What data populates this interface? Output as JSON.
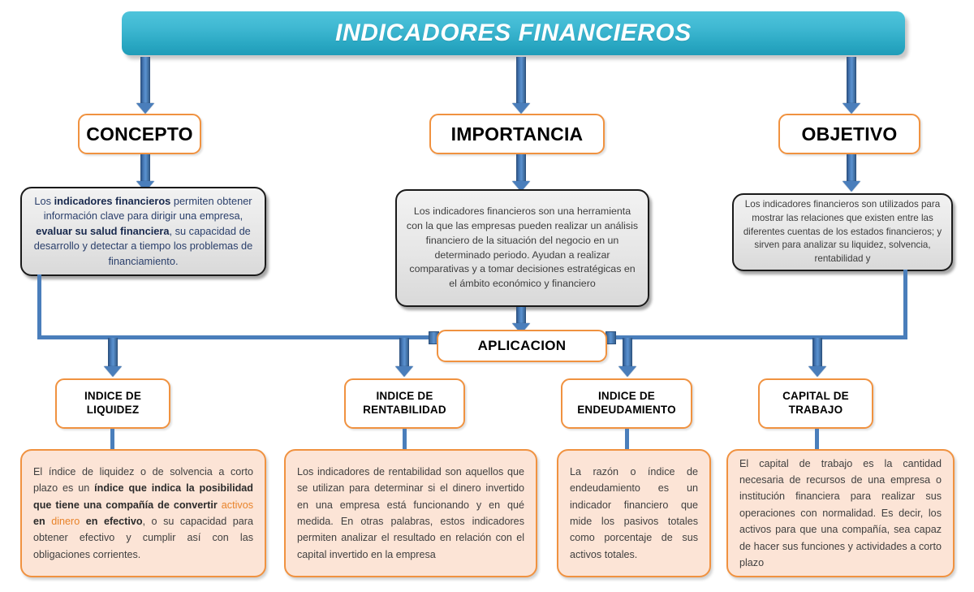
{
  "banner": {
    "title": "INDICADORES FINANCIEROS"
  },
  "colors": {
    "banner_teal": "#3fb8d2",
    "node_border_orange": "#f09240",
    "arrow_blue": "#4a7ebb",
    "peach_fill": "#fce4d6",
    "gray_fill": "#e6e6e6",
    "highlight_orange": "#e8832a",
    "blue_text": "#2a3f6b"
  },
  "level1": [
    {
      "id": "concepto",
      "label": "CONCEPTO"
    },
    {
      "id": "importancia",
      "label": "IMPORTANCIA"
    },
    {
      "id": "objetivo",
      "label": "OBJETIVO"
    }
  ],
  "descriptions": {
    "concepto": {
      "part1": "Los ",
      "bold1": "indicadores financieros",
      "part2": " permiten obtener información clave para dirigir una empresa, ",
      "bold2": "evaluar su salud financiera",
      "part3": ", su capacidad de desarrollo y detectar a tiempo los problemas de financiamiento."
    },
    "importancia": {
      "text": "Los indicadores financieros son una herramienta con la que las empresas pueden realizar un análisis financiero de la situación del negocio en un determinado periodo. Ayudan a realizar comparativas y a tomar decisiones estratégicas en el ámbito económico y financiero"
    },
    "objetivo": {
      "text": "Los indicadores financieros son utilizados para mostrar las relaciones que existen entre las diferentes cuentas de los estados financieros; y sirven para analizar su liquidez, solvencia, rentabilidad y"
    }
  },
  "aplicacion": {
    "label": "APLICACION"
  },
  "level3": [
    {
      "id": "liquidez",
      "line1": "INDICE DE",
      "line2": "LIQUIDEZ"
    },
    {
      "id": "rentabilidad",
      "line1": "INDICE DE",
      "line2": "RENTABILIDAD"
    },
    {
      "id": "endeudamiento",
      "line1": "INDICE DE",
      "line2": "ENDEUDAMIENTO"
    },
    {
      "id": "capital",
      "line1": "CAPITAL DE",
      "line2": "TRABAJO"
    }
  ],
  "details": {
    "liquidez": {
      "part1": "El índice de liquidez o de solvencia a corto plazo es un ",
      "bold1": "índice que indica la posibilidad que tiene una compañía de convertir ",
      "hl1": "activos",
      "bold2": " en ",
      "hl2": "dinero",
      "bold3": " en efectivo",
      "part2": ", o su capacidad para obtener efectivo y cumplir así con las obligaciones corrientes."
    },
    "rentabilidad": {
      "text": "Los indicadores de rentabilidad son aquellos que se utilizan para determinar si el dinero invertido en una empresa está funcionando y en qué medida. En otras palabras, estos indicadores permiten analizar el resultado en relación con el capital invertido en la empresa"
    },
    "endeudamiento": {
      "text": "La razón o índice de endeudamiento es un indicador financiero que mide los pasivos totales como porcentaje de sus activos totales."
    },
    "capital": {
      "text": "El capital de trabajo es la cantidad necesaria de recursos de una empresa o institución financiera para realizar sus operaciones con normalidad. Es decir, los activos para que una compañía, sea capaz de hacer sus funciones y actividades a corto plazo"
    }
  }
}
